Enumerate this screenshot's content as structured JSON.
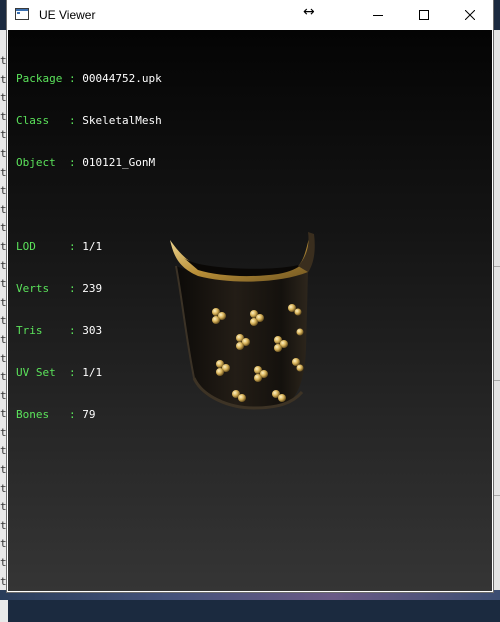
{
  "window": {
    "title": "UE Viewer"
  },
  "info": {
    "rows": [
      {
        "label": "Package",
        "sep": " : ",
        "value": "00044752.upk"
      },
      {
        "label": "Class  ",
        "sep": " : ",
        "value": "SkeletalMesh"
      },
      {
        "label": "Object ",
        "sep": " : ",
        "value": "010121_GonM"
      }
    ],
    "mesh_rows": [
      {
        "label": "LOD    ",
        "sep": " : ",
        "value": "1/1"
      },
      {
        "label": "Verts  ",
        "sep": " : ",
        "value": "239"
      },
      {
        "label": "Tris   ",
        "sep": " : ",
        "value": "303"
      },
      {
        "label": "UV Set ",
        "sep": " : ",
        "value": "1/1"
      },
      {
        "label": "Bones  ",
        "sep": " : ",
        "value": "79"
      }
    ]
  },
  "background_strip": {
    "chars": [
      "t",
      "t",
      "t",
      "t",
      "t",
      "t",
      "t",
      "t",
      "t",
      "t",
      "t",
      "t",
      "t",
      "t",
      "t",
      "t",
      "t",
      "t",
      "t",
      "t",
      "t",
      "t",
      "t",
      "t",
      "t",
      "t",
      "t",
      "t",
      "t"
    ]
  },
  "colors": {
    "label_green": "#5be35b",
    "value_white": "#ffffff",
    "model_gold": "#c9a44a"
  },
  "icons": {
    "app": "app-window-icon",
    "resize": "resize-arrows-icon",
    "minimize": "minimize-icon",
    "maximize": "maximize-icon",
    "close": "close-icon"
  }
}
